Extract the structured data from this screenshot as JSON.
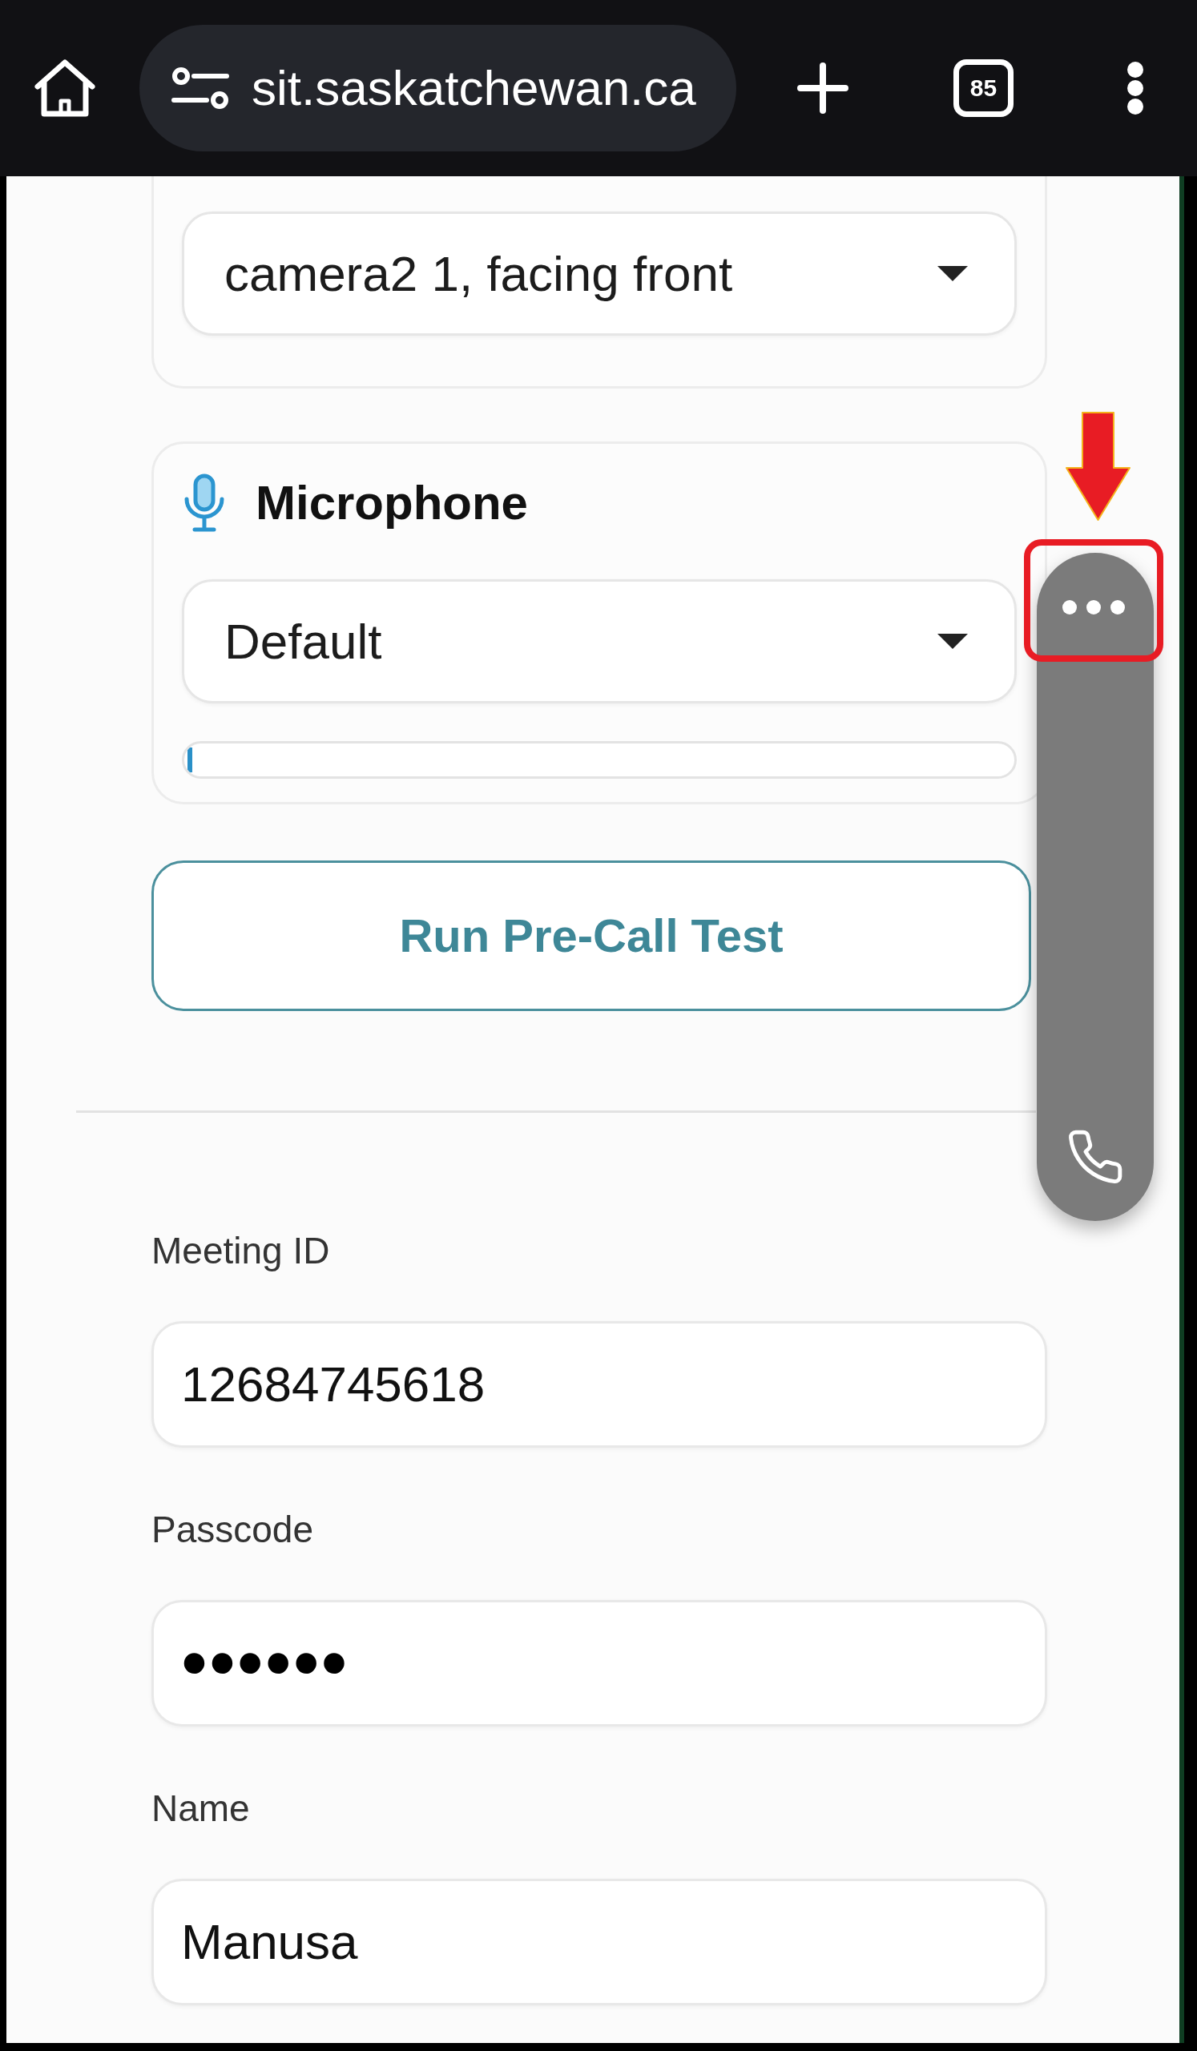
{
  "browser_bar": {
    "url": "sit.saskatchewan.ca",
    "tab_count": "85"
  },
  "camera": {
    "device": "camera2 1, facing front"
  },
  "microphone": {
    "title": "Microphone",
    "device": "Default",
    "level": 0.006
  },
  "pre_call_button": {
    "label": "Run Pre-Call Test"
  },
  "fields": [
    {
      "label": "Meeting ID",
      "value": "12684745618",
      "kind": "text"
    },
    {
      "label": "Passcode",
      "value": "••••••",
      "kind": "password"
    },
    {
      "label": "Name",
      "value": "Manusa",
      "kind": "text"
    }
  ]
}
